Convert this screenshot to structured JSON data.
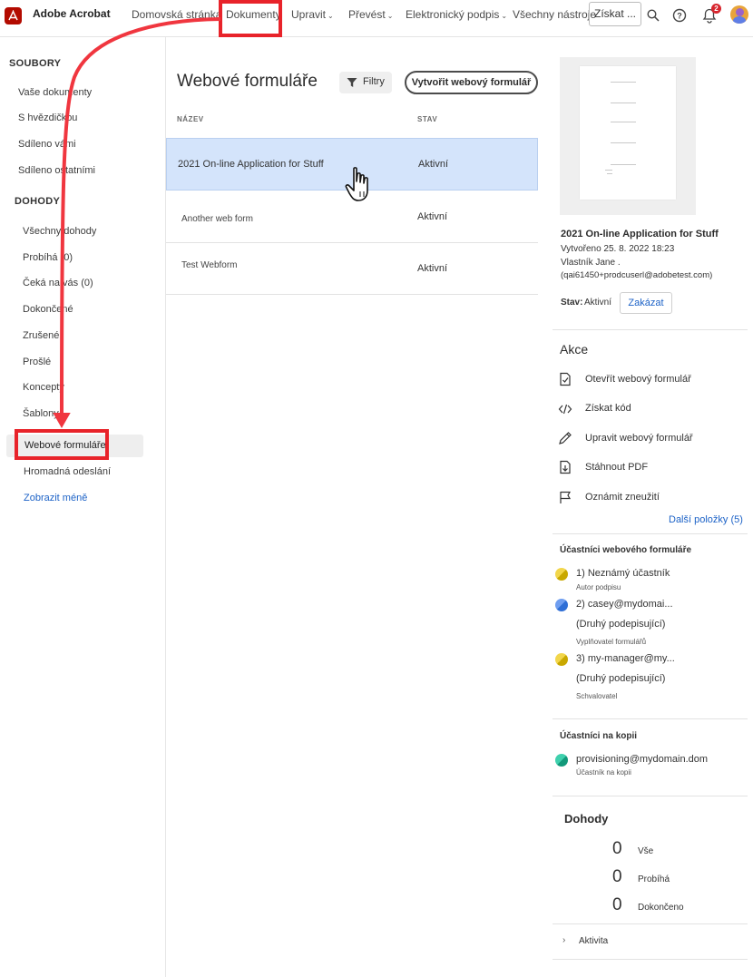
{
  "topbar": {
    "app_name": "Adobe Acrobat",
    "nav": [
      {
        "label": "Domovská stránka",
        "dropdown": false
      },
      {
        "label": "Dokumenty",
        "dropdown": false
      },
      {
        "label": "Upravit",
        "dropdown": true
      },
      {
        "label": "Převést",
        "dropdown": true
      },
      {
        "label": "Elektronický podpis",
        "dropdown": true
      },
      {
        "label": "Všechny nástroje",
        "dropdown": false
      }
    ],
    "get_button": "Získat ...",
    "notification_count": "2"
  },
  "sidebar": {
    "files_heading": "SOUBORY",
    "files": [
      "Vaše dokumenty",
      "S hvězdičkou",
      "Sdíleno vámi",
      "Sdíleno ostatními"
    ],
    "agreements_heading": "DOHODY",
    "agreements": [
      "Všechny dohody",
      "Probíhá (0)",
      "Čeká na vás (0)",
      "Dokončené",
      "Zrušené",
      "Prošlé",
      "Koncepty",
      "Šablony"
    ],
    "active_item": "Webové formuláře",
    "bulk_item": "Hromadná odeslání",
    "show_less": "Zobrazit méně"
  },
  "main": {
    "title": "Webové formuláře",
    "filter_label": "Filtry",
    "create_label": "Vytvořit webový formulář",
    "col_name": "NÁZEV",
    "col_status": "STAV",
    "rows": [
      {
        "name": "2021 On-line Application for Stuff",
        "status": "Aktivní",
        "selected": true
      },
      {
        "name": "Another web form",
        "status": "Aktivní",
        "selected": false
      },
      {
        "name": "Test Webform",
        "status": "Aktivní",
        "selected": false
      }
    ]
  },
  "detail": {
    "title": "2021 On-line Application for Stuff",
    "created": "Vytvořeno 25. 8. 2022 18:23",
    "owner": "Vlastník Jane .",
    "owner_email": "(qai61450+prodcuserl@adobetest.com)",
    "status_label": "Stav:",
    "status_value": "Aktivní",
    "disable_label": "Zakázat",
    "actions_heading": "Akce",
    "actions": [
      {
        "label": "Otevřít webový formulář",
        "icon": "open-form-icon"
      },
      {
        "label": "Získat kód",
        "icon": "code-icon"
      },
      {
        "label": "Upravit webový formulář",
        "icon": "pencil-icon"
      },
      {
        "label": "Stáhnout PDF",
        "icon": "download-pdf-icon"
      },
      {
        "label": "Oznámit zneužití",
        "icon": "flag-icon"
      }
    ],
    "more_items": "Další položky (5)",
    "participants_heading": "Účastníci webového formuláře",
    "participants": [
      {
        "name": "1) Neznámý účastník",
        "extra": "",
        "role": "Autor podpisu",
        "color": "#e5c200"
      },
      {
        "name": "2) casey@mydomai...",
        "extra": "(Druhý podepisující)",
        "role": "Vyplňovatel formulářů",
        "color": "#3d7fe0"
      },
      {
        "name": "3) my-manager@my...",
        "extra": "(Druhý podepisující)",
        "role": "Schvalovatel",
        "color": "#e5c200"
      }
    ],
    "cc_heading": "Účastníci na kopii",
    "cc": {
      "name": "provisioning@mydomain.dom",
      "role": "Účastník na kopii",
      "color": "#1fae8f"
    },
    "agreements_heading": "Dohody",
    "agreement_counts": [
      {
        "count": "0",
        "label": "Vše"
      },
      {
        "count": "0",
        "label": "Probíhá"
      },
      {
        "count": "0",
        "label": "Dokončeno"
      }
    ],
    "activity_label": "Aktivita"
  },
  "colors": {
    "accent": "#e8232a",
    "link": "#1c62c7",
    "selected_row": "#d4e4fb",
    "brand": "#b30b00"
  }
}
